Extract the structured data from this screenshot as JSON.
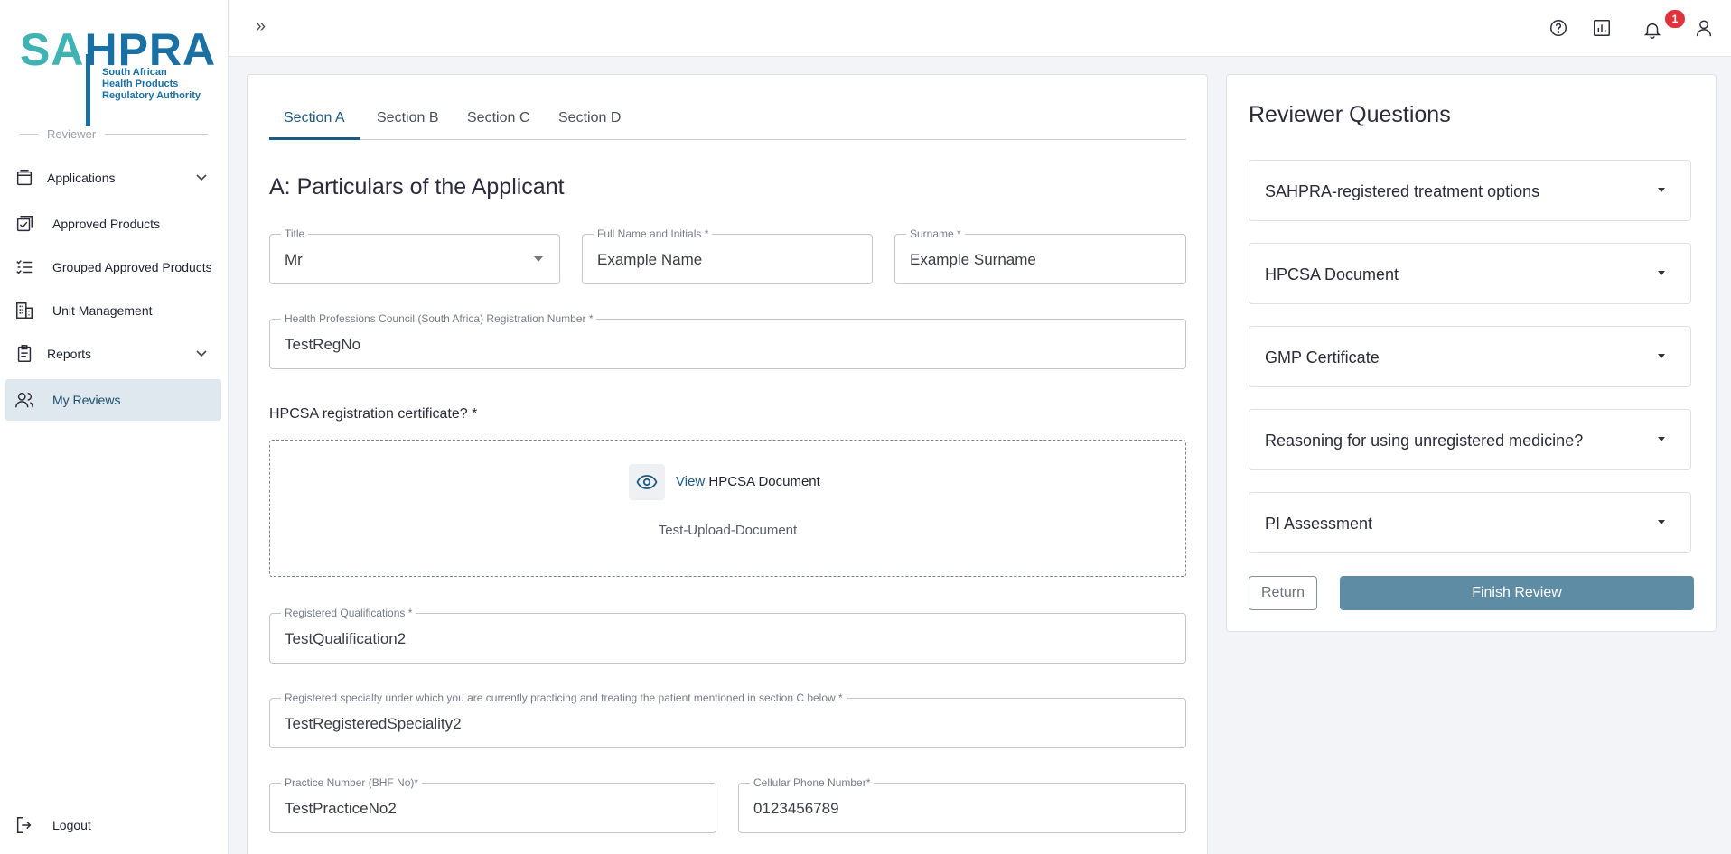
{
  "logo": {
    "sa": "SA",
    "hpra": "HPRA",
    "line1": "South African",
    "line2": "Health Products",
    "line3": "Regulatory Authority"
  },
  "sidebar": {
    "role": "Reviewer",
    "items": [
      {
        "label": "Applications",
        "icon": "applications-icon"
      },
      {
        "label": "Approved Products",
        "icon": "approved-products-icon"
      },
      {
        "label": "Grouped Approved Products",
        "icon": "grouped-list-icon"
      },
      {
        "label": "Unit Management",
        "icon": "building-icon"
      },
      {
        "label": "Reports",
        "icon": "clipboard-icon"
      },
      {
        "label": "My Reviews",
        "icon": "users-icon"
      }
    ],
    "logout": "Logout"
  },
  "topbar": {
    "expand": "»",
    "notification_count": "1"
  },
  "tabs": [
    "Section A",
    "Section B",
    "Section C",
    "Section D"
  ],
  "section_title": "A: Particulars of the Applicant",
  "form": {
    "title": {
      "label": "Title",
      "value": "Mr"
    },
    "full_name": {
      "label": "Full Name and Initials *",
      "value": "Example Name"
    },
    "surname": {
      "label": "Surname *",
      "value": "Example Surname"
    },
    "reg_number": {
      "label": "Health Professions Council (South Africa) Registration Number *",
      "value": "TestRegNo"
    },
    "hpcsa_question": "HPCSA registration certificate? *",
    "upload": {
      "view": "View",
      "doc": "HPCSA Document",
      "file_name": "Test-Upload-Document"
    },
    "qualifications": {
      "label": "Registered Qualifications *",
      "value": "TestQualification2"
    },
    "specialty": {
      "label": "Registered specialty under which you are currently practicing and treating the patient mentioned in section C below *",
      "value": "TestRegisteredSpeciality2"
    },
    "practice_no": {
      "label": "Practice Number (BHF No)*",
      "value": "TestPracticeNo2"
    },
    "cell_phone": {
      "label": "Cellular Phone Number*",
      "value": "0123456789"
    }
  },
  "reviewer": {
    "title": "Reviewer Questions",
    "questions": [
      "SAHPRA-registered treatment options",
      "HPCSA Document",
      "GMP Certificate",
      "Reasoning for using unregistered medicine?",
      "PI Assessment"
    ],
    "return_label": "Return",
    "finish_label": "Finish Review"
  },
  "colors": {
    "accent": "#1d5a80",
    "finish_button": "#5d8ca4",
    "badge": "#e0323b",
    "logo_teal": "#3fb2b4",
    "logo_blue": "#1a6fa3"
  }
}
